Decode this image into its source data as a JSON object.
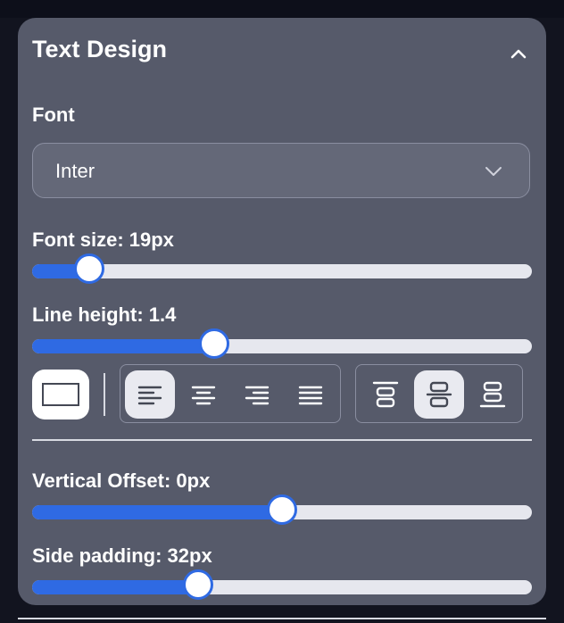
{
  "panel": {
    "title": "Text Design",
    "collapse_icon": "chevron-up-icon"
  },
  "font": {
    "label": "Font",
    "selected": "Inter",
    "dropdown_icon": "chevron-down-icon"
  },
  "font_size": {
    "label": "Font size: 19px",
    "value_fraction": 0.114
  },
  "line_height": {
    "label": "Line height: 1.4",
    "value_fraction": 0.364
  },
  "alignment": {
    "box_toggle_icon": "rectangle-outline-icon",
    "horizontal": [
      {
        "icon": "align-left-icon",
        "active": true
      },
      {
        "icon": "align-center-icon",
        "active": false
      },
      {
        "icon": "align-right-icon",
        "active": false
      },
      {
        "icon": "align-justify-icon",
        "active": false
      }
    ],
    "vertical": [
      {
        "icon": "align-top-icon",
        "active": false
      },
      {
        "icon": "align-middle-icon",
        "active": true
      },
      {
        "icon": "align-bottom-icon",
        "active": false
      }
    ]
  },
  "vertical_offset": {
    "label": "Vertical Offset: 0px",
    "value_fraction": 0.5
  },
  "side_padding": {
    "label": "Side padding: 32px",
    "value_fraction": 0.332
  },
  "colors": {
    "accent": "#2f6ae3",
    "panel_bg": "#565a6a",
    "page_bg": "#12141f",
    "track": "#e6e7ee"
  }
}
